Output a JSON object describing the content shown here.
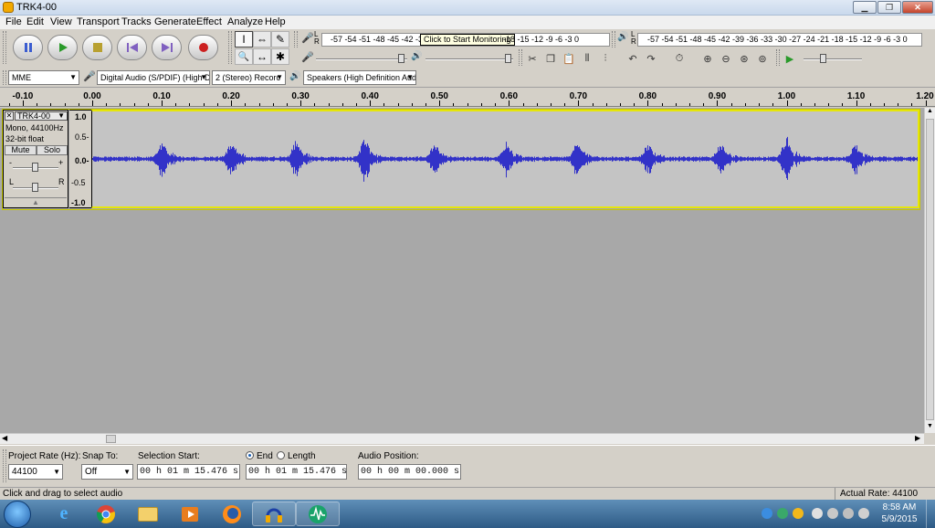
{
  "window": {
    "title": "TRK4-00",
    "min": "0",
    "max": "1",
    "close": "✕"
  },
  "menu": [
    "File",
    "Edit",
    "View",
    "Transport",
    "Tracks",
    "Generate",
    "Effect",
    "Analyze",
    "Help"
  ],
  "transport": {
    "icons": [
      "pause-icon",
      "play-icon",
      "stop-icon",
      "skip-start-icon",
      "skip-end-icon",
      "record-icon"
    ]
  },
  "tools": {
    "glyphs": [
      "I",
      "⇔",
      "✎",
      "🔍",
      "↔",
      "✱"
    ]
  },
  "meters": {
    "record_labels": "-57 -54 -51 -48 -45 -42 -3",
    "record_labels_right": "-18 -15 -12 -9 -6 -3 0",
    "tooltip": "Click to Start Monitoring",
    "play_labels": "-57 -54 -51 -48 -45 -42 -39 -36 -33 -30 -27 -24 -21 -18 -15 -12 -9 -6 -3 0",
    "lr_left": "L",
    "lr_right": "R"
  },
  "device": {
    "host": "MME",
    "input": "Digital Audio (S/PDIF) (High De",
    "channels": "2 (Stereo) Recorc",
    "output": "Speakers (High Definition Aud"
  },
  "ruler": {
    "labels": [
      "-0.10",
      "0.00",
      "0.10",
      "0.20",
      "0.30",
      "0.40",
      "0.50",
      "0.60",
      "0.70",
      "0.80",
      "0.90",
      "1.00",
      "1.10",
      "1.20"
    ]
  },
  "track": {
    "close": "✕",
    "name": "TRK4-00",
    "format": "Mono, 44100Hz",
    "bitdepth": "32-bit float",
    "mute": "Mute",
    "solo": "Solo",
    "gain_minus": "-",
    "gain_plus": "+",
    "pan_l": "L",
    "pan_r": "R",
    "scale": [
      "1.0",
      "0.5-",
      "0.0-",
      "-0.5",
      "-1.0"
    ]
  },
  "selection_bar": {
    "project_rate_label": "Project Rate (Hz):",
    "project_rate": "44100",
    "snap_label": "Snap To:",
    "snap_value": "Off",
    "sel_start_label": "Selection Start:",
    "end_label": "End",
    "length_label": "Length",
    "sel_start": "00 h 01 m 15.476 s",
    "sel_end": "00 h 01 m 15.476 s",
    "audio_pos_label": "Audio Position:",
    "audio_pos": "00 h 00 m 00.000 s"
  },
  "status": {
    "left": "Click and drag to select audio",
    "right": "Actual Rate: 44100"
  },
  "taskbar": {
    "time": "8:58 AM",
    "date": "5/9/2015",
    "apps": [
      "start-orb",
      "internet-explorer-icon",
      "chrome-icon",
      "file-explorer-icon",
      "media-player-icon",
      "firefox-icon",
      "audacity-icon",
      "spectrum-app-icon"
    ]
  },
  "colors": {
    "waveform": "#3232c8",
    "wave_bg": "#c4c4c4",
    "track_border": "#e6e60a",
    "track_area": "#a8a8a8"
  },
  "waveform": {
    "bursts": [
      {
        "t": 0.1,
        "amp": 0.26
      },
      {
        "t": 0.2,
        "amp": 0.3
      },
      {
        "t": 0.293,
        "amp": 0.28
      },
      {
        "t": 0.392,
        "amp": 0.34
      },
      {
        "t": 0.493,
        "amp": 0.24
      },
      {
        "t": 0.596,
        "amp": 0.27
      },
      {
        "t": 0.698,
        "amp": 0.24
      },
      {
        "t": 0.8,
        "amp": 0.22
      },
      {
        "t": 0.905,
        "amp": 0.25
      },
      {
        "t": 1.0,
        "amp": 0.36
      },
      {
        "t": 1.1,
        "amp": 0.24
      }
    ],
    "t_start": 0.0,
    "t_end": 1.19,
    "noise_amp": 0.04
  }
}
